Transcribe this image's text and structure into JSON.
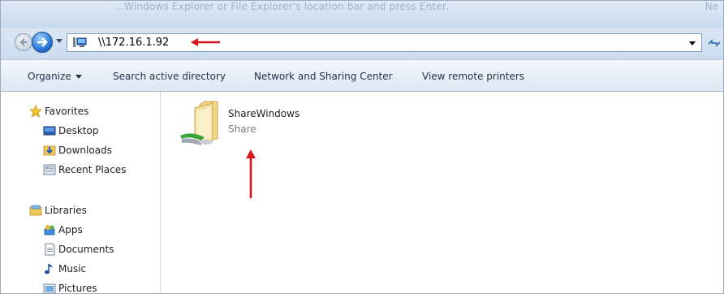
{
  "window": {
    "title_fragment": "...Windows Explorer or File Explorer's location bar and press Enter.",
    "title_right_fragment": "Ne"
  },
  "navigation": {
    "back_icon": "back-arrow-icon",
    "forward_icon": "forward-arrow-icon",
    "address": "\\\\172.16.1.92",
    "address_icon": "network-computer-icon"
  },
  "commandbar": {
    "organize": "Organize",
    "search": "Search active directory",
    "network": "Network and Sharing Center",
    "printers": "View remote printers"
  },
  "sidebar": {
    "favorites": {
      "label": "Favorites",
      "items": [
        {
          "label": "Desktop",
          "icon": "desktop-icon"
        },
        {
          "label": "Downloads",
          "icon": "downloads-folder-icon"
        },
        {
          "label": "Recent Places",
          "icon": "recent-places-icon"
        }
      ]
    },
    "libraries": {
      "label": "Libraries",
      "items": [
        {
          "label": "Apps",
          "icon": "apps-library-icon"
        },
        {
          "label": "Documents",
          "icon": "documents-icon"
        },
        {
          "label": "Music",
          "icon": "music-icon"
        },
        {
          "label": "Pictures",
          "icon": "pictures-icon"
        }
      ]
    }
  },
  "content": {
    "items": [
      {
        "name": "ShareWindows",
        "type": "Share",
        "icon": "shared-folder-icon"
      }
    ]
  },
  "colors": {
    "annotation_arrow": "#d9131b",
    "chrome_blue": "#cbdcef",
    "text_muted": "#7d7d7d"
  }
}
